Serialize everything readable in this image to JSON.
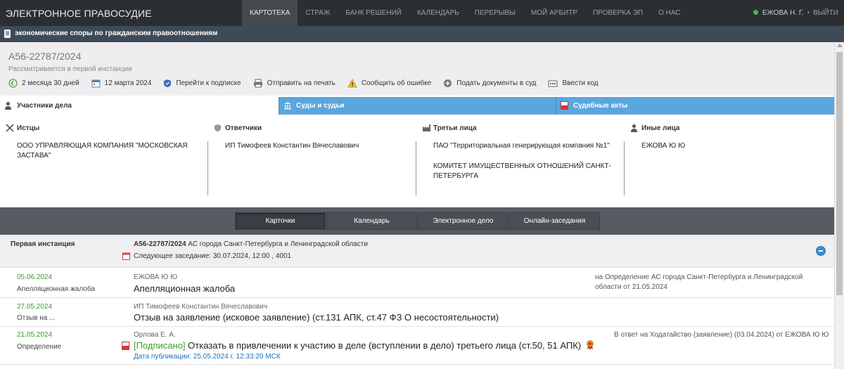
{
  "app": {
    "brand": "ЭЛЕКТРОННОЕ ПРАВОСУДИЕ",
    "nav": [
      "КАРТОТЕКА",
      "СТРАЖ",
      "БАНК РЕШЕНИЙ",
      "КАЛЕНДАРЬ",
      "ПЕРЕРЫВЫ",
      "МОЙ АРБИТР",
      "ПРОВЕРКА ЭП",
      "О НАС"
    ],
    "user": "ЕЖОВА Н. Г.",
    "separator": "•",
    "logout": "ВЫЙТИ"
  },
  "category": "экономические споры по гражданским правоотношениям",
  "case": {
    "number": "А56-22787/2024",
    "status": "Рассматривается в первой инстанции",
    "actions": [
      "2 месяца 30 дней",
      "12 марта 2024",
      "Перейти к подписке",
      "Отправить на печать",
      "Сообщить об ошибке",
      "Подать документы в суд",
      "Ввести код"
    ]
  },
  "tabs": [
    "Участники дела",
    "Суды и судьи",
    "Судебные акты"
  ],
  "participants": {
    "plaintiffs": {
      "title": "Истцы",
      "items": [
        "ООО УПРАВЛЯЮЩАЯ КОМПАНИЯ \"МОСКОВСКАЯ ЗАСТАВА\""
      ]
    },
    "defendants": {
      "title": "Ответчики",
      "items": [
        "ИП Тимофеев Константин Вячеславович"
      ]
    },
    "third": {
      "title": "Третьи лица",
      "items": [
        "ПАО \"Территориальная генерирующая компания №1\"",
        "КОМИТЕТ ИМУЩЕСТВЕННЫХ ОТНОШЕНИЙ САНКТ-ПЕТЕРБУРГА"
      ]
    },
    "others": {
      "title": "Иные лица",
      "items": [
        "ЕЖОВА Ю Ю"
      ]
    }
  },
  "band_buttons": [
    "Карточки",
    "Календарь",
    "Электронное дело",
    "Онлайн-заседания"
  ],
  "instance": {
    "label": "Первая инстанция",
    "case_number": "А56-22787/2024",
    "court": "АС города Санкт-Петербурга и Ленинградской области",
    "next_hearing": "Следующее заседание: 30.07.2024, 12:00 , 4001"
  },
  "documents": [
    {
      "date": "05.06.2024",
      "type": "Апелляционная жалоба",
      "author": "ЕЖОВА Ю Ю",
      "title": "Апелляционная жалоба",
      "note": "на Определение АС города Санкт-Петербурга и Ленинградской области от 21.05.2024"
    },
    {
      "date": "27.05.2024",
      "type": "Отзыв на ...",
      "author": "ИП Тимофеев Константин Вячеславович",
      "title": "Отзыв на заявление (исковое заявление) (ст.131 АПК, ст.47 ФЗ О несостоятельности)"
    },
    {
      "date": "21.05.2024",
      "type": "Определение",
      "author": "Орлова Е. А.",
      "signed": "[Подписано]",
      "title": "Отказать в привлечении к участию в деле (вступлении в дело) третьего лица (ст.50, 51 АПК)",
      "note": "В ответ на Ходатайство (заявление) (03.04.2024) от ЕЖОВА Ю Ю",
      "published": "Дата публикации: 25.05.2024 г. 12:33:20 МСК"
    }
  ],
  "colors": {
    "topbar": "#2b2e33",
    "tab_blue": "#5aa6de",
    "date_green": "#3d9a2f",
    "link_blue": "#1e73be"
  }
}
